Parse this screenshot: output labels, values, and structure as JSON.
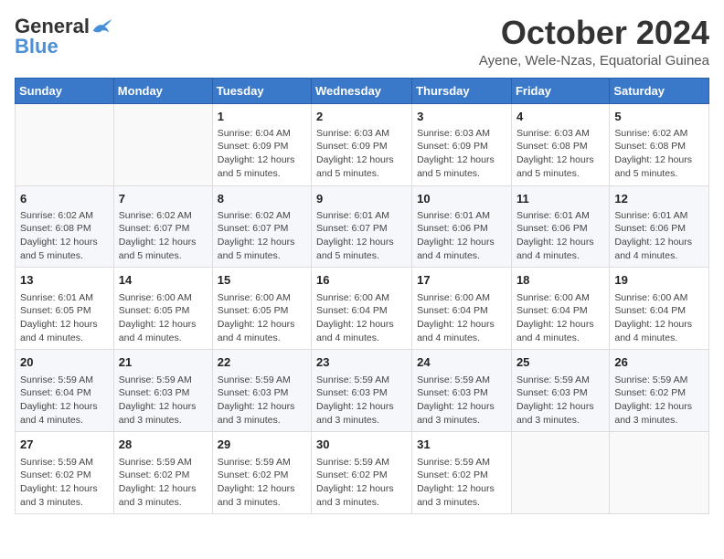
{
  "header": {
    "logo_general": "General",
    "logo_blue": "Blue",
    "month_title": "October 2024",
    "location": "Ayene, Wele-Nzas, Equatorial Guinea"
  },
  "days_of_week": [
    "Sunday",
    "Monday",
    "Tuesday",
    "Wednesday",
    "Thursday",
    "Friday",
    "Saturday"
  ],
  "weeks": [
    [
      {
        "day": "",
        "content": ""
      },
      {
        "day": "",
        "content": ""
      },
      {
        "day": "1",
        "content": "Sunrise: 6:04 AM\nSunset: 6:09 PM\nDaylight: 12 hours and 5 minutes."
      },
      {
        "day": "2",
        "content": "Sunrise: 6:03 AM\nSunset: 6:09 PM\nDaylight: 12 hours and 5 minutes."
      },
      {
        "day": "3",
        "content": "Sunrise: 6:03 AM\nSunset: 6:09 PM\nDaylight: 12 hours and 5 minutes."
      },
      {
        "day": "4",
        "content": "Sunrise: 6:03 AM\nSunset: 6:08 PM\nDaylight: 12 hours and 5 minutes."
      },
      {
        "day": "5",
        "content": "Sunrise: 6:02 AM\nSunset: 6:08 PM\nDaylight: 12 hours and 5 minutes."
      }
    ],
    [
      {
        "day": "6",
        "content": "Sunrise: 6:02 AM\nSunset: 6:08 PM\nDaylight: 12 hours and 5 minutes."
      },
      {
        "day": "7",
        "content": "Sunrise: 6:02 AM\nSunset: 6:07 PM\nDaylight: 12 hours and 5 minutes."
      },
      {
        "day": "8",
        "content": "Sunrise: 6:02 AM\nSunset: 6:07 PM\nDaylight: 12 hours and 5 minutes."
      },
      {
        "day": "9",
        "content": "Sunrise: 6:01 AM\nSunset: 6:07 PM\nDaylight: 12 hours and 5 minutes."
      },
      {
        "day": "10",
        "content": "Sunrise: 6:01 AM\nSunset: 6:06 PM\nDaylight: 12 hours and 4 minutes."
      },
      {
        "day": "11",
        "content": "Sunrise: 6:01 AM\nSunset: 6:06 PM\nDaylight: 12 hours and 4 minutes."
      },
      {
        "day": "12",
        "content": "Sunrise: 6:01 AM\nSunset: 6:06 PM\nDaylight: 12 hours and 4 minutes."
      }
    ],
    [
      {
        "day": "13",
        "content": "Sunrise: 6:01 AM\nSunset: 6:05 PM\nDaylight: 12 hours and 4 minutes."
      },
      {
        "day": "14",
        "content": "Sunrise: 6:00 AM\nSunset: 6:05 PM\nDaylight: 12 hours and 4 minutes."
      },
      {
        "day": "15",
        "content": "Sunrise: 6:00 AM\nSunset: 6:05 PM\nDaylight: 12 hours and 4 minutes."
      },
      {
        "day": "16",
        "content": "Sunrise: 6:00 AM\nSunset: 6:04 PM\nDaylight: 12 hours and 4 minutes."
      },
      {
        "day": "17",
        "content": "Sunrise: 6:00 AM\nSunset: 6:04 PM\nDaylight: 12 hours and 4 minutes."
      },
      {
        "day": "18",
        "content": "Sunrise: 6:00 AM\nSunset: 6:04 PM\nDaylight: 12 hours and 4 minutes."
      },
      {
        "day": "19",
        "content": "Sunrise: 6:00 AM\nSunset: 6:04 PM\nDaylight: 12 hours and 4 minutes."
      }
    ],
    [
      {
        "day": "20",
        "content": "Sunrise: 5:59 AM\nSunset: 6:04 PM\nDaylight: 12 hours and 4 minutes."
      },
      {
        "day": "21",
        "content": "Sunrise: 5:59 AM\nSunset: 6:03 PM\nDaylight: 12 hours and 3 minutes."
      },
      {
        "day": "22",
        "content": "Sunrise: 5:59 AM\nSunset: 6:03 PM\nDaylight: 12 hours and 3 minutes."
      },
      {
        "day": "23",
        "content": "Sunrise: 5:59 AM\nSunset: 6:03 PM\nDaylight: 12 hours and 3 minutes."
      },
      {
        "day": "24",
        "content": "Sunrise: 5:59 AM\nSunset: 6:03 PM\nDaylight: 12 hours and 3 minutes."
      },
      {
        "day": "25",
        "content": "Sunrise: 5:59 AM\nSunset: 6:03 PM\nDaylight: 12 hours and 3 minutes."
      },
      {
        "day": "26",
        "content": "Sunrise: 5:59 AM\nSunset: 6:02 PM\nDaylight: 12 hours and 3 minutes."
      }
    ],
    [
      {
        "day": "27",
        "content": "Sunrise: 5:59 AM\nSunset: 6:02 PM\nDaylight: 12 hours and 3 minutes."
      },
      {
        "day": "28",
        "content": "Sunrise: 5:59 AM\nSunset: 6:02 PM\nDaylight: 12 hours and 3 minutes."
      },
      {
        "day": "29",
        "content": "Sunrise: 5:59 AM\nSunset: 6:02 PM\nDaylight: 12 hours and 3 minutes."
      },
      {
        "day": "30",
        "content": "Sunrise: 5:59 AM\nSunset: 6:02 PM\nDaylight: 12 hours and 3 minutes."
      },
      {
        "day": "31",
        "content": "Sunrise: 5:59 AM\nSunset: 6:02 PM\nDaylight: 12 hours and 3 minutes."
      },
      {
        "day": "",
        "content": ""
      },
      {
        "day": "",
        "content": ""
      }
    ]
  ]
}
